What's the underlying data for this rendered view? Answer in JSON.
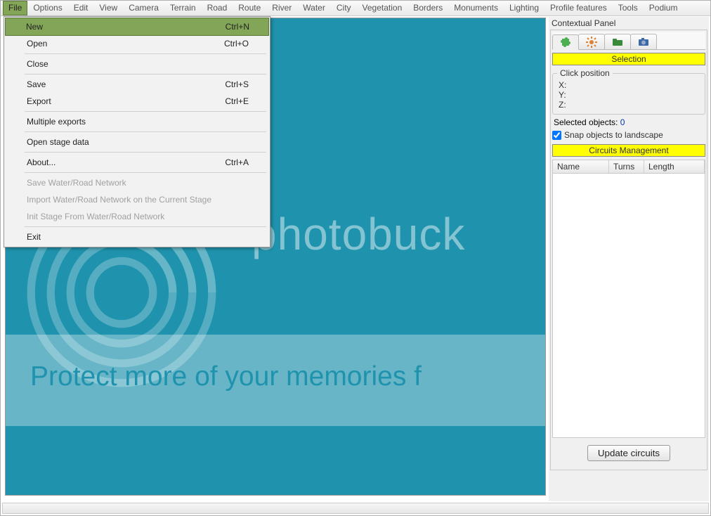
{
  "menubar": {
    "items": [
      "File",
      "Options",
      "Edit",
      "View",
      "Camera",
      "Terrain",
      "Road",
      "Route",
      "River",
      "Water",
      "City",
      "Vegetation",
      "Borders",
      "Monuments",
      "Lighting",
      "Profile features",
      "Tools",
      "Podium"
    ],
    "active_index": 0
  },
  "file_menu": {
    "items": [
      {
        "label": "New",
        "shortcut": "Ctrl+N",
        "enabled": true,
        "highlight": true
      },
      {
        "label": "Open",
        "shortcut": "Ctrl+O",
        "enabled": true
      },
      {
        "sep": true
      },
      {
        "label": "Close",
        "shortcut": "",
        "enabled": true
      },
      {
        "sep": true
      },
      {
        "label": "Save",
        "shortcut": "Ctrl+S",
        "enabled": true
      },
      {
        "label": "Export",
        "shortcut": "Ctrl+E",
        "enabled": true
      },
      {
        "sep": true
      },
      {
        "label": "Multiple exports",
        "shortcut": "",
        "enabled": true
      },
      {
        "sep": true
      },
      {
        "label": "Open stage data",
        "shortcut": "",
        "enabled": true
      },
      {
        "sep": true
      },
      {
        "label": "About...",
        "shortcut": "Ctrl+A",
        "enabled": true
      },
      {
        "sep": true
      },
      {
        "label": "Save Water/Road Network",
        "shortcut": "",
        "enabled": false
      },
      {
        "label": "Import Water/Road Network on the Current Stage",
        "shortcut": "",
        "enabled": false
      },
      {
        "label": "Init Stage From Water/Road Network",
        "shortcut": "",
        "enabled": false
      },
      {
        "sep": true
      },
      {
        "label": "Exit",
        "shortcut": "",
        "enabled": true
      }
    ]
  },
  "viewport": {
    "watermark_brand": "photobuck",
    "banner_text": "Protect more of your memories f"
  },
  "sidepanel": {
    "title": "Contextual Panel",
    "tabs": [
      {
        "icon": "puzzle-icon",
        "active": true
      },
      {
        "icon": "gear-icon",
        "active": false
      },
      {
        "icon": "folder-icon",
        "active": false
      },
      {
        "icon": "camera-icon",
        "active": false
      }
    ],
    "selection_header": "Selection",
    "click_position": {
      "title": "Click position",
      "x_label": "X:",
      "x_val": "",
      "y_label": "Y:",
      "y_val": "",
      "z_label": "Z:",
      "z_val": ""
    },
    "selected_objects_label": "Selected objects:",
    "selected_objects_count": "0",
    "snap_checked": true,
    "snap_label": "Snap objects to landscape",
    "circuits_header": "Circuits Management",
    "grid_columns": [
      "Name",
      "Turns",
      "Length"
    ],
    "update_btn": "Update circuits"
  }
}
